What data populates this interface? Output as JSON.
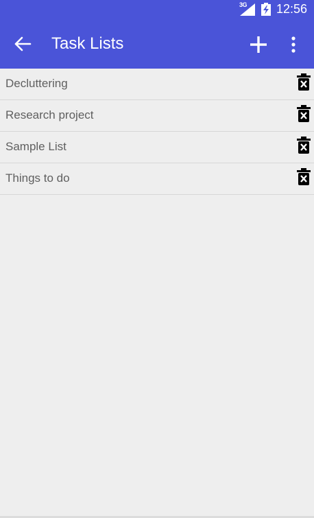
{
  "status_bar": {
    "network": "3G",
    "time": "12:56",
    "signal_icon": "signal-icon",
    "battery_icon": "battery-charging-icon"
  },
  "app_bar": {
    "title": "Task Lists",
    "back_icon": "arrow-back-icon",
    "add_icon": "plus-icon",
    "menu_icon": "more-vert-icon",
    "color": "#4a54d8"
  },
  "task_lists": [
    {
      "name": "Decluttering",
      "delete_icon": "delete-icon"
    },
    {
      "name": "Research project",
      "delete_icon": "delete-icon"
    },
    {
      "name": "Sample List",
      "delete_icon": "delete-icon"
    },
    {
      "name": "Things to do",
      "delete_icon": "delete-icon"
    }
  ]
}
